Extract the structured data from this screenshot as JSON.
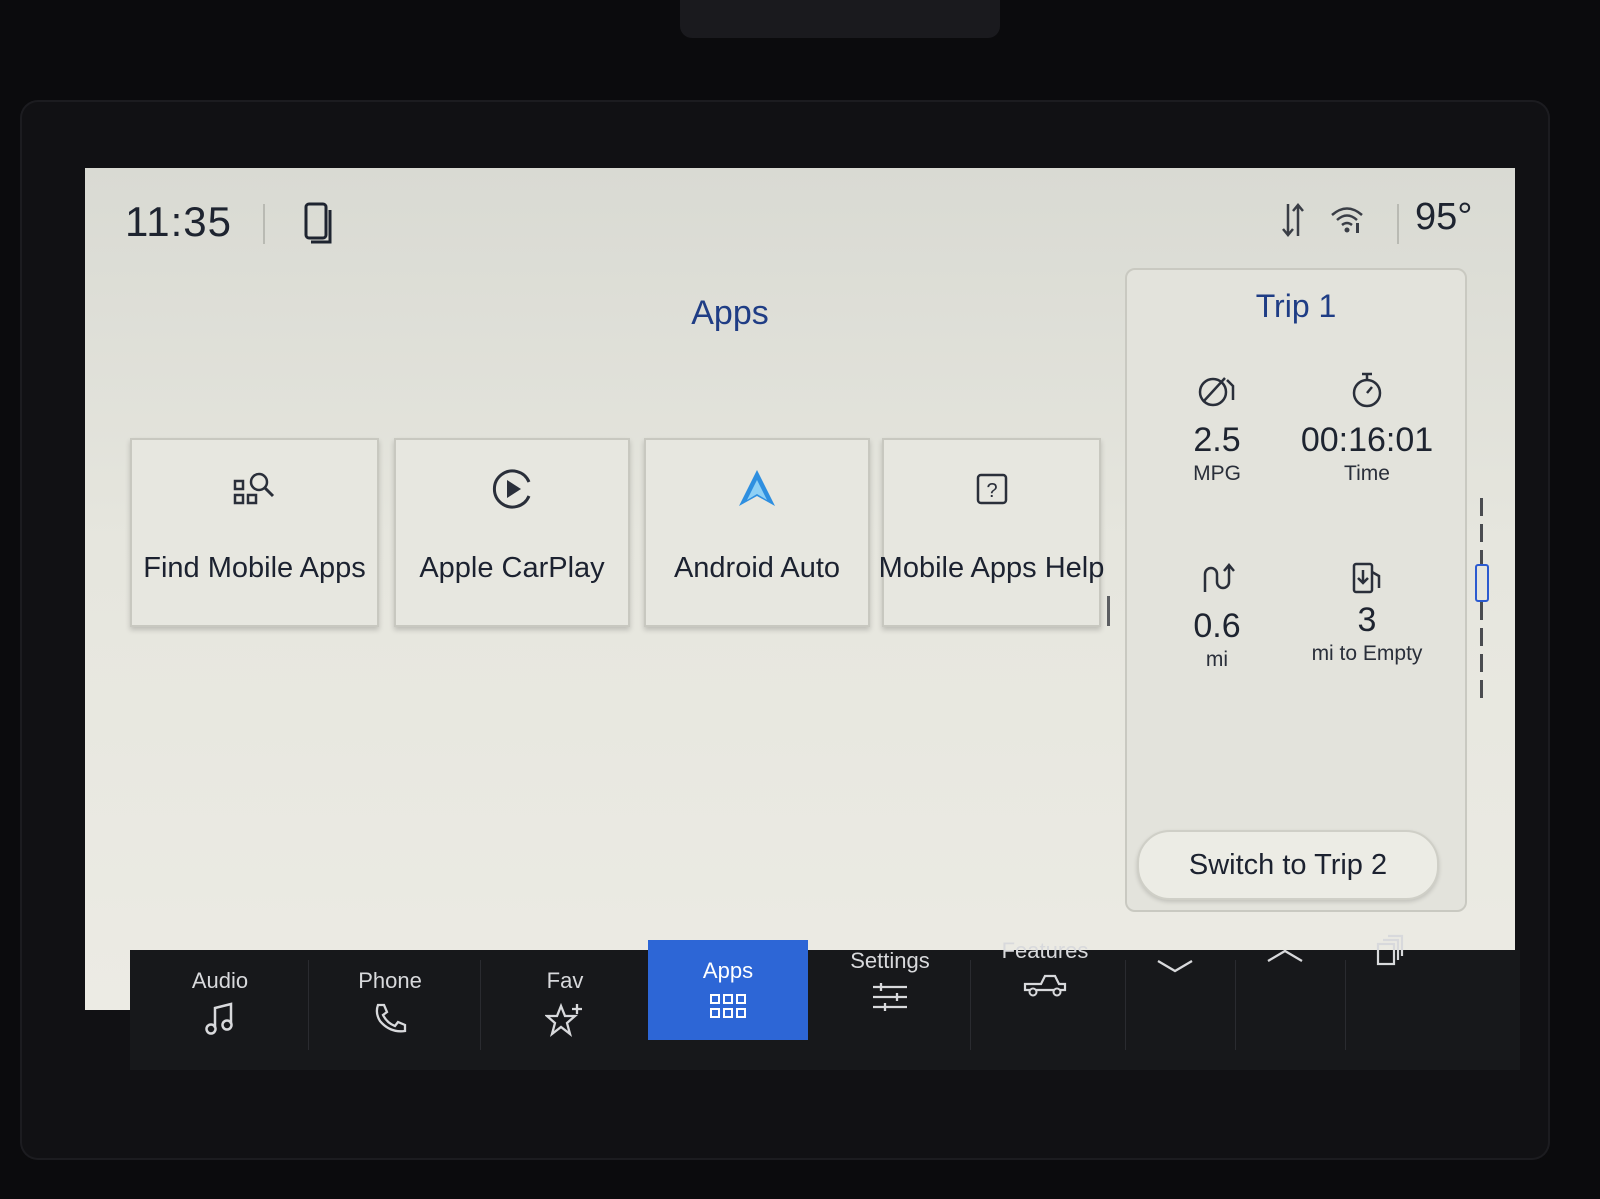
{
  "status_bar": {
    "time": "11:35",
    "temperature": "95°"
  },
  "apps_screen": {
    "title": "Apps",
    "tiles": [
      {
        "label": "Find Mobile Apps",
        "icon": "find-apps-icon"
      },
      {
        "label": "Apple CarPlay",
        "icon": "carplay-icon"
      },
      {
        "label": "Android Auto",
        "icon": "android-auto-icon"
      },
      {
        "label": "Mobile Apps Help",
        "icon": "help-icon"
      }
    ]
  },
  "trip_panel": {
    "title": "Trip 1",
    "metrics": [
      {
        "value": "2.5",
        "unit": "MPG",
        "icon": "fuel-economy-icon"
      },
      {
        "value": "00:16:01",
        "unit": "Time",
        "icon": "stopwatch-icon"
      },
      {
        "value": "0.6",
        "unit": "mi",
        "icon": "distance-icon"
      },
      {
        "value": "3",
        "unit": "mi to Empty",
        "icon": "fuel-pump-icon"
      }
    ],
    "switch_button": "Switch to Trip 2"
  },
  "nav": {
    "items": [
      {
        "label": "Audio",
        "icon": "music-note-icon"
      },
      {
        "label": "Phone",
        "icon": "phone-handset-icon"
      },
      {
        "label": "Fav",
        "icon": "star-plus-icon"
      },
      {
        "label": "Apps",
        "icon": "grid-icon",
        "active": true
      },
      {
        "label": "Settings",
        "icon": "sliders-icon"
      },
      {
        "label": "Features",
        "icon": "truck-icon"
      }
    ],
    "extra_icons": [
      "chevron-down-icon",
      "chevron-up-icon",
      "layers-icon"
    ]
  },
  "colors": {
    "accent": "#2d66d6",
    "title_blue": "#1f3d85",
    "android_auto": "#2e8fe0"
  }
}
